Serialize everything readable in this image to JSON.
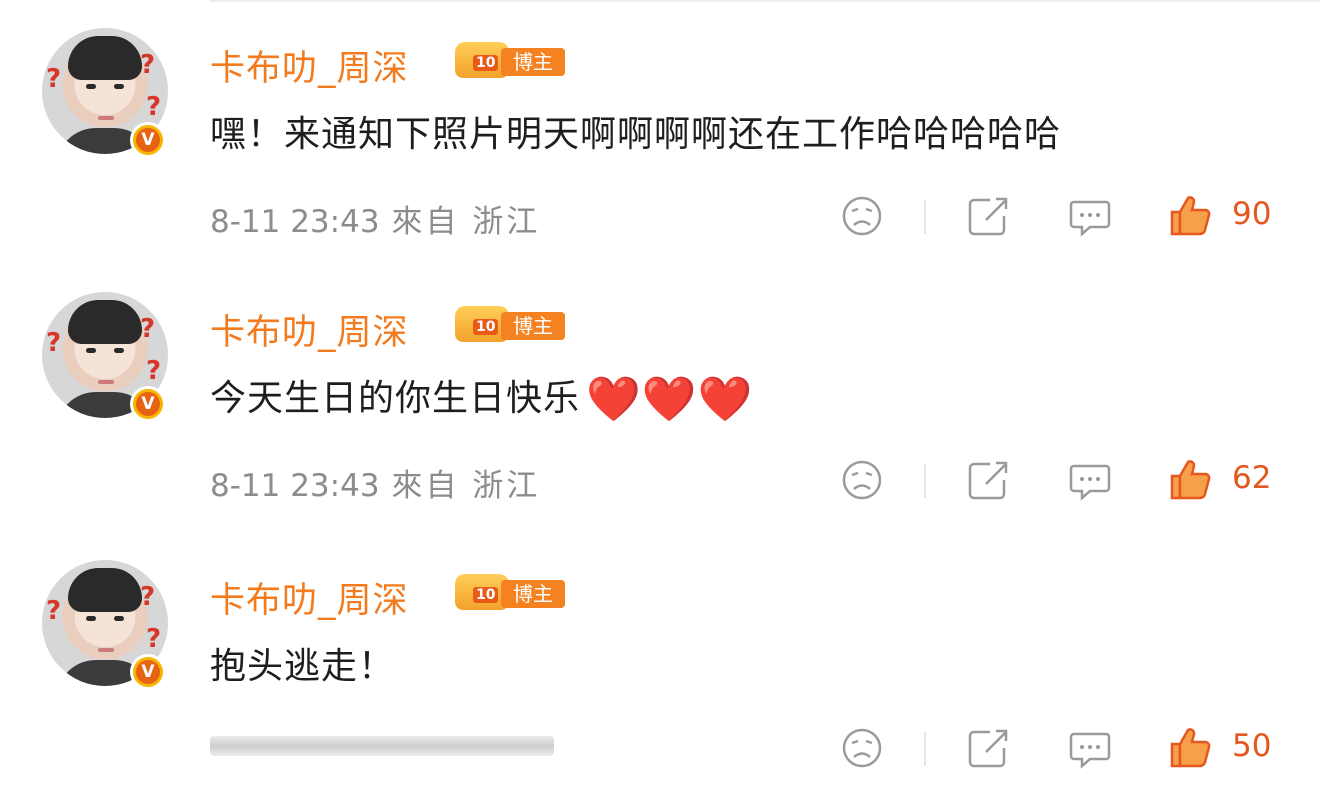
{
  "comments": [
    {
      "username": "卡布叻_周深",
      "level": "10",
      "role_tag": "博主",
      "verified_mark": "V",
      "text": "嘿！来通知下照片明天啊啊啊啊还在工作哈哈哈哈哈",
      "hearts": "",
      "date": "8-11 23:43",
      "location": "來自 浙江",
      "likes": "90"
    },
    {
      "username": "卡布叻_周深",
      "level": "10",
      "role_tag": "博主",
      "verified_mark": "V",
      "text": "今天生日的你生日快乐",
      "hearts": "❤️❤️❤️",
      "date": "8-11 23:43",
      "location": "來自 浙江",
      "likes": "62"
    },
    {
      "username": "卡布叻_周深",
      "level": "10",
      "role_tag": "博主",
      "verified_mark": "V",
      "text": "抱头逃走！",
      "hearts": "",
      "date": "",
      "location": "",
      "likes": "50"
    }
  ],
  "colors": {
    "username": "#f37b1d",
    "like_accent": "#e4571e",
    "meta_gray": "#8c8c8c"
  },
  "icons": [
    "dislike-face-icon",
    "share-icon",
    "reply-icon",
    "like-thumb-icon"
  ]
}
